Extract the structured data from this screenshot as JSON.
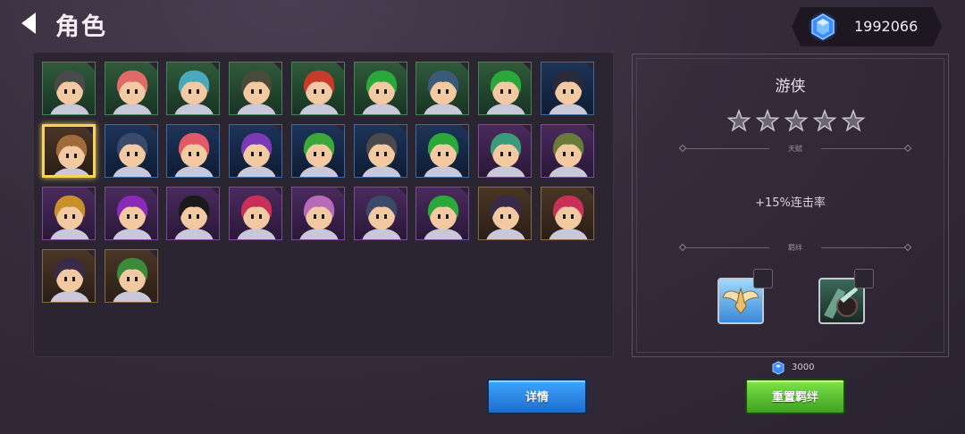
{
  "header": {
    "title": "角色",
    "currency_value": "1992066"
  },
  "roster": [
    {
      "frame": "green",
      "hair": "#4a4a4a"
    },
    {
      "frame": "green",
      "hair": "#e06a6a"
    },
    {
      "frame": "green",
      "hair": "#4aa8b8"
    },
    {
      "frame": "green",
      "hair": "#4a4a3a"
    },
    {
      "frame": "green",
      "hair": "#c83a2a"
    },
    {
      "frame": "green",
      "hair": "#2aa83a"
    },
    {
      "frame": "green",
      "hair": "#3a5a7a"
    },
    {
      "frame": "green",
      "hair": "#2aa83a"
    },
    {
      "frame": "blue",
      "hair": "#2a2a3a"
    },
    {
      "frame": "gold",
      "hair": "#a06a3a"
    },
    {
      "frame": "blue",
      "hair": "#3a4a6a"
    },
    {
      "frame": "blue",
      "hair": "#e05a6a"
    },
    {
      "frame": "blue",
      "hair": "#7a3ab8"
    },
    {
      "frame": "blue",
      "hair": "#3aa83a"
    },
    {
      "frame": "blue",
      "hair": "#4a4a4a"
    },
    {
      "frame": "blue",
      "hair": "#2aa83a"
    },
    {
      "frame": "purple",
      "hair": "#3a9a7a"
    },
    {
      "frame": "purple",
      "hair": "#6a7a3a"
    },
    {
      "frame": "purple",
      "hair": "#c8902a"
    },
    {
      "frame": "purple",
      "hair": "#8a2ab8"
    },
    {
      "frame": "purple",
      "hair": "#1a1a1a"
    },
    {
      "frame": "purple",
      "hair": "#c8305a"
    },
    {
      "frame": "purple",
      "hair": "#b86ab8"
    },
    {
      "frame": "purple",
      "hair": "#3a4a6a"
    },
    {
      "frame": "purple",
      "hair": "#2aa83a"
    },
    {
      "frame": "brown",
      "hair": "#3a2a4a"
    },
    {
      "frame": "brown",
      "hair": "#c8305a"
    },
    {
      "frame": "brown",
      "hair": "#3a2a4a"
    },
    {
      "frame": "brown",
      "hair": "#3a8a3a"
    }
  ],
  "info": {
    "name": "游侠",
    "stars": 5,
    "talent_label": "天赋",
    "talent_text": "+15%连击率",
    "bond_label": "羁绊",
    "bond_icons": [
      "wings-emblem-icon",
      "dark-warrior-icon"
    ]
  },
  "cost": "3000",
  "buttons": {
    "details": "详情",
    "reset_bond": "重置羁绊"
  },
  "colors": {
    "gem": "#3a8cff",
    "details_btn": "#2a8aee",
    "reset_btn": "#5cc835",
    "selected": "#f4d35e"
  }
}
